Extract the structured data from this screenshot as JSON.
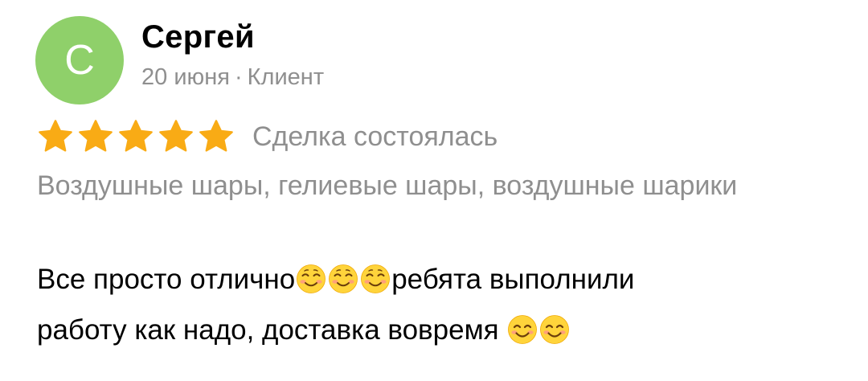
{
  "review": {
    "author": {
      "initial": "С",
      "name": "Сергей",
      "avatar_color": "#8fd06a"
    },
    "date": "20 июня",
    "separator": "·",
    "role": "Клиент",
    "rating": 5,
    "rating_max": 5,
    "star_color": "#f9ab15",
    "deal_status": "Сделка состоялась",
    "category": "Воздушные шары, гелиевые шары, воздушные шарики",
    "text_parts": {
      "p1": "Все просто отлично",
      "p2": "ребята выполнили",
      "p3": "работу как надо, доставка вовремя "
    },
    "emoji": {
      "blush": "smiling-face-icon",
      "smile": "smiling-face-with-smiling-eyes-icon"
    }
  }
}
